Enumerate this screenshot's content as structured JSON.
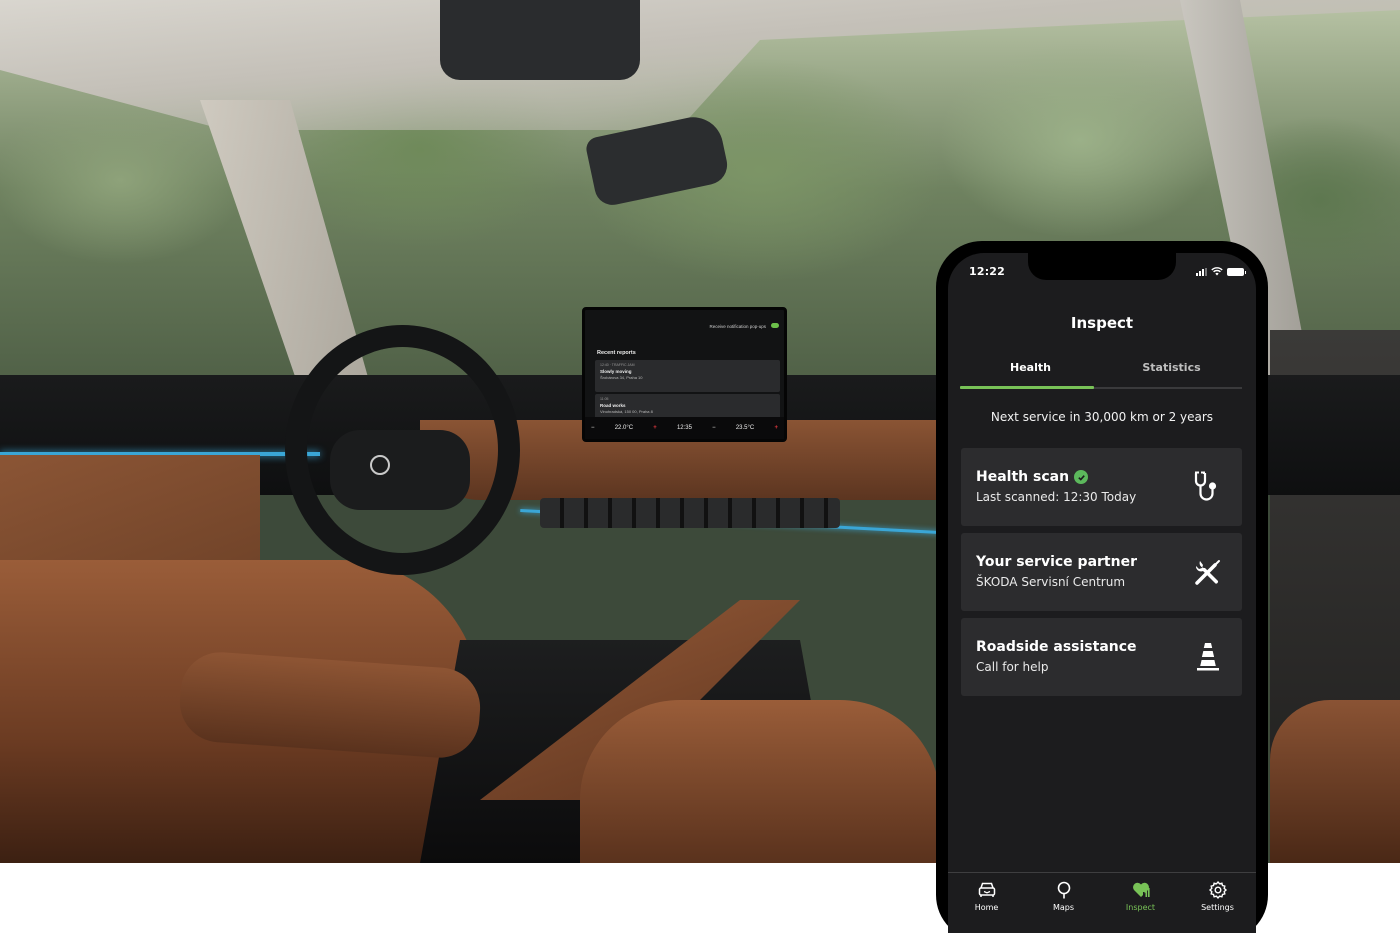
{
  "infotainment": {
    "toggle_label": "Receive notification pop-ups",
    "title": "Recent reports",
    "reports": [
      {
        "meta": "12:40 · TRAFFIC JAM",
        "title": "Slowly moving",
        "subtitle": "Šrobárova 34, Praha 10"
      },
      {
        "meta": "11:05",
        "title": "Road works",
        "subtitle": "Vinohradská, 150 00, Praha 8"
      }
    ],
    "climate_left": "22.0°C",
    "clock": "12:35",
    "climate_right": "23.5°C",
    "minus": "−",
    "plus": "+"
  },
  "phone": {
    "status_time": "12:22",
    "title": "Inspect",
    "tabs": [
      {
        "label": "Health",
        "active": true
      },
      {
        "label": "Statistics",
        "active": false
      }
    ],
    "next_service": "Next service in 30,000 km or 2 years",
    "cards": [
      {
        "title": "Health scan",
        "subtitle": "Last scanned: 12:30 Today",
        "icon": "stethoscope-icon",
        "verified": true
      },
      {
        "title": "Your service partner",
        "subtitle": "ŠKODA Servisní Centrum",
        "icon": "tools-icon"
      },
      {
        "title": "Roadside assistance",
        "subtitle": "Call for help",
        "icon": "traffic-cone-icon"
      }
    ],
    "nav": [
      {
        "label": "Home",
        "icon": "car-icon",
        "active": false
      },
      {
        "label": "Maps",
        "icon": "map-pin-icon",
        "active": false
      },
      {
        "label": "Inspect",
        "icon": "heart-stats-icon",
        "active": true
      },
      {
        "label": "Settings",
        "icon": "gear-icon",
        "active": false
      }
    ],
    "accent_color": "#78c257"
  }
}
